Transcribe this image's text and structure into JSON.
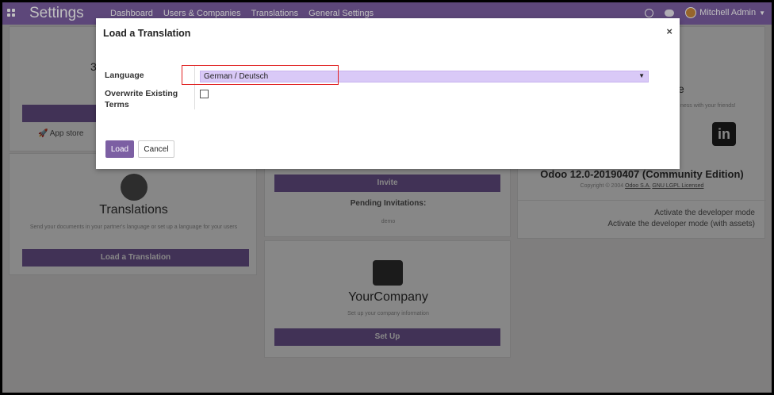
{
  "navbar": {
    "title": "Settings",
    "menu": [
      "Dashboard",
      "Users & Companies",
      "Translations",
      "General Settings"
    ],
    "user": "Mitchell Admin"
  },
  "left_top": {
    "heading_fragment": "3",
    "app_store_label": "App store"
  },
  "translations_card": {
    "title": "Translations",
    "description": "Send your documents in your partner's language or set up a language for your users",
    "button": "Load a Translation"
  },
  "mid_top": {
    "invite_button": "Invite",
    "pending_label": "Pending Invitations:",
    "pending_user": "demo"
  },
  "company_card": {
    "title": "YourCompany",
    "description": "Set up your company information",
    "button": "Set Up"
  },
  "right_card": {
    "heading_fragment": "e",
    "share_text": "ness with your friends!",
    "version": "Odoo 12.0-20190407 (Community Edition)",
    "copyright_prefix": "Copyright © 2004",
    "copyright_company": "Odoo S.A.",
    "license": "GNU LGPL Licensed",
    "dev_mode": "Activate the developer mode",
    "dev_mode_assets": "Activate the developer mode (with assets)"
  },
  "modal": {
    "title": "Load a Translation",
    "close": "×",
    "language_label": "Language",
    "language_value": "German / Deutsch",
    "overwrite_label": "Overwrite Existing Terms",
    "load_button": "Load",
    "cancel_button": "Cancel"
  },
  "colors": {
    "brand": "#7c5fa3",
    "select_bg": "#d9c9f7",
    "highlight": "#e02020"
  }
}
